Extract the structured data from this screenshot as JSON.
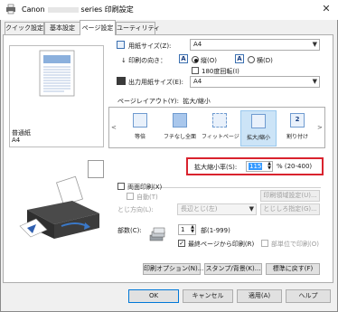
{
  "window": {
    "title_prefix": "Canon",
    "title_suffix": "series 印刷設定",
    "close_glyph": "✕"
  },
  "tabs": [
    {
      "label": "クイック設定"
    },
    {
      "label": "基本設定"
    },
    {
      "label": "ページ設定"
    },
    {
      "label": "ユーティリティ"
    }
  ],
  "left_panel": {
    "media_type": "普通紙",
    "paper_size": "A4"
  },
  "page_setup": {
    "page_size_label": "用紙サイズ(Z):",
    "page_size_value": "A4",
    "orientation_label": "印刷の向き：",
    "orientation_portrait": "縦(O)",
    "orientation_landscape": "横(D)",
    "rotate_180": "180度回転(I)",
    "output_size_label": "出力用紙サイズ(E):",
    "output_size_value": "A4",
    "layout_label": "ページレイアウト(Y):",
    "layout_value": "拡大/縮小",
    "layouts": [
      {
        "label": "等倍"
      },
      {
        "label": "フチなし全面"
      },
      {
        "label": "フィットページ"
      },
      {
        "label": "拡大/縮小"
      },
      {
        "label": "割り付け"
      }
    ],
    "scale_label": "拡大縮小率(S):",
    "scale_value": "115",
    "scale_range": "% (20-400)",
    "duplex_label": "両面印刷(X)",
    "duplex_auto": "自動(T)",
    "duplex_settings_btn": "印刷領域設定(U)...",
    "binding_label": "とじ方向(L):",
    "binding_value": "長辺とじ(左)",
    "margin_btn": "とじしろ指定(G)...",
    "copies_label": "部数(C):",
    "copies_value": "1",
    "copies_range": "部(1-999)",
    "last_page_first": "最終ページから印刷(R)",
    "collate": "部単位で印刷(O)",
    "options_btn": "印刷オプション(N)...",
    "stamp_btn": "スタンプ/背景(K)...",
    "defaults_btn": "標準に戻す(F)"
  },
  "footer": {
    "ok": "OK",
    "cancel": "キャンセル",
    "apply": "適用(A)",
    "help": "ヘルプ"
  },
  "colors": {
    "highlight_border": "#d9232e",
    "selection": "#3399ff"
  }
}
